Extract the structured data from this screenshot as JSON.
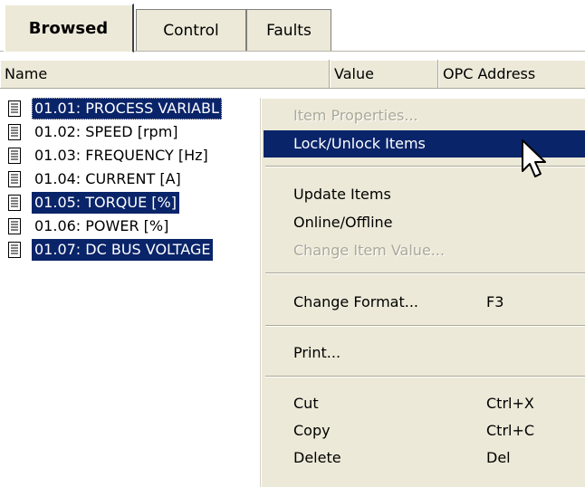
{
  "tabs": [
    {
      "label": "Browsed",
      "active": true
    },
    {
      "label": "Control",
      "active": false
    },
    {
      "label": "Faults",
      "active": false
    }
  ],
  "columns": [
    "Name",
    "Value",
    "OPC Address"
  ],
  "items": [
    {
      "label": "01.01: PROCESS VARIABL",
      "selected": true
    },
    {
      "label": "01.02: SPEED [rpm]",
      "selected": false
    },
    {
      "label": "01.03: FREQUENCY [Hz]",
      "selected": false
    },
    {
      "label": "01.04: CURRENT [A]",
      "selected": false
    },
    {
      "label": "01.05: TORQUE [%]",
      "selected": true
    },
    {
      "label": "01.06: POWER [%]",
      "selected": false
    },
    {
      "label": "01.07: DC BUS VOLTAGE",
      "selected": true
    }
  ],
  "context_menu": {
    "item_properties": "Item Properties...",
    "lock_unlock": "Lock/Unlock Items",
    "update_items": "Update Items",
    "online_offline": "Online/Offline",
    "change_item_value": "Change Item Value...",
    "change_format": "Change Format...",
    "change_format_key": "F3",
    "print": "Print...",
    "cut": "Cut",
    "cut_key": "Ctrl+X",
    "copy": "Copy",
    "copy_key": "Ctrl+C",
    "delete": "Delete",
    "delete_key": "Del"
  },
  "colors": {
    "selection": "#0a246a",
    "face": "#ece9d8",
    "disabled": "#aca899"
  },
  "icons": {
    "item": "document-icon",
    "pointer": "mouse-cursor-icon"
  }
}
